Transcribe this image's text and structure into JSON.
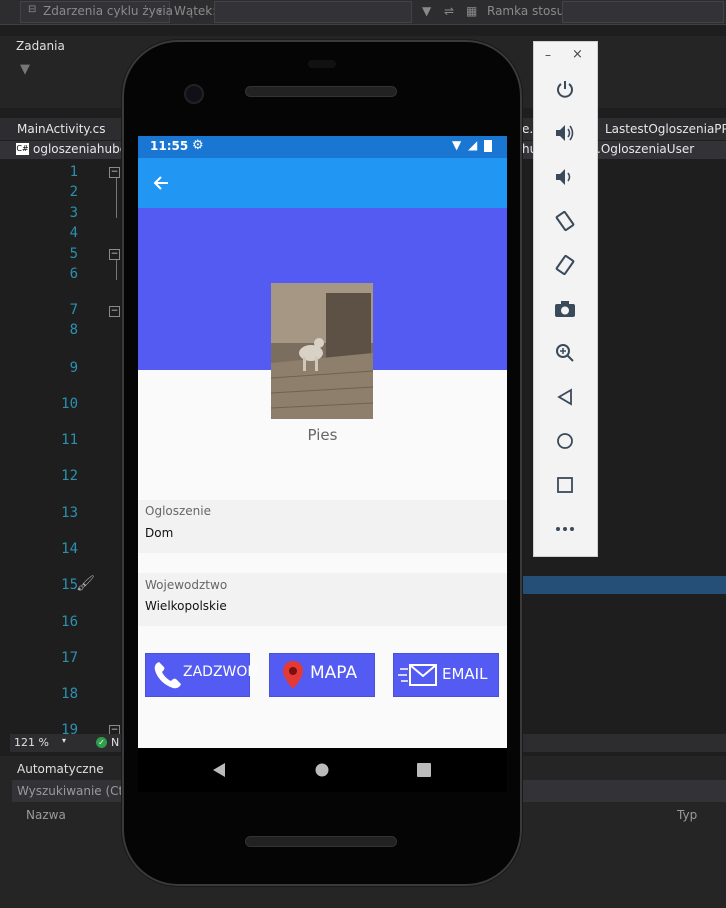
{
  "ide": {
    "toolbar": {
      "lifecycle_events": "Zdarzenia cyklu życia",
      "thread_label": "Wątek:",
      "stack_frame_label": "Ramka stosu:"
    },
    "tasks_panel_title": "Zadania",
    "tabs": [
      "MainActivity.cs",
      "LastestOgloszeniaPPag"
    ],
    "tab_fragment": "e.x",
    "nav": {
      "left": "ogloszeniahuber",
      "middle": "hu",
      "right": ".OgloszeniaUser"
    },
    "line_numbers": [
      "1",
      "2",
      "3",
      "4",
      "5",
      "6",
      "7",
      "8",
      "9",
      "10",
      "11",
      "12",
      "13",
      "14",
      "15",
      "16",
      "17",
      "18",
      "19"
    ],
    "zoom": "121 %",
    "status_fragment": "N",
    "auto_panel": {
      "title": "Automatyczne",
      "search_placeholder": "Wyszukiwanie (Ctrl+",
      "col_name": "Nazwa",
      "col_type": "Typ"
    },
    "colors": {
      "background": "#1e1e1e",
      "line_number": "#2b91af"
    }
  },
  "emulator": {
    "status_bar": {
      "time": "11:55"
    },
    "app": {
      "pet_name": "Pies",
      "fields": [
        {
          "label": "Ogloszenie",
          "value": "Dom"
        },
        {
          "label": "Wojewodztwo",
          "value": "Wielkopolskie"
        }
      ],
      "buttons": [
        {
          "label": "ZADZWOŃ",
          "icon": "phone-icon"
        },
        {
          "label": "MAPA",
          "icon": "map-pin-icon"
        },
        {
          "label": "EMAIL",
          "icon": "mail-icon"
        }
      ],
      "colors": {
        "app_bar": "#2196f3",
        "status_bar": "#1976d2",
        "accent": "#535bf2"
      }
    },
    "side_toolbar": {
      "icons": [
        "power-icon",
        "volume-up-icon",
        "volume-down-icon",
        "rotate-left-icon",
        "rotate-right-icon",
        "camera-icon",
        "zoom-icon",
        "back-icon",
        "home-icon",
        "overview-icon",
        "more-icon"
      ]
    }
  }
}
